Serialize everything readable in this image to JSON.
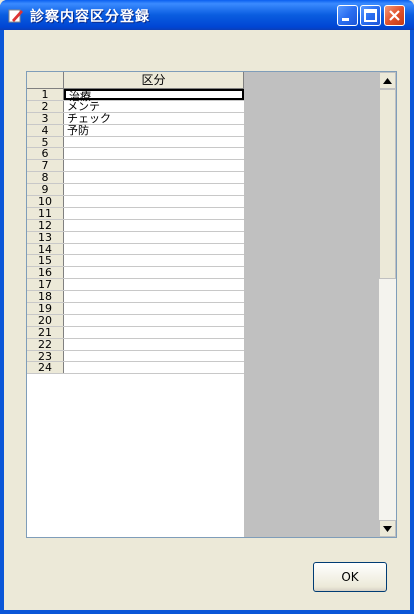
{
  "window": {
    "title": "診察内容区分登録"
  },
  "grid": {
    "column_header": "区分",
    "rows": [
      {
        "num": "1",
        "value": "治療"
      },
      {
        "num": "2",
        "value": "メンテ"
      },
      {
        "num": "3",
        "value": "チェック"
      },
      {
        "num": "4",
        "value": "予防"
      },
      {
        "num": "5",
        "value": ""
      },
      {
        "num": "6",
        "value": ""
      },
      {
        "num": "7",
        "value": ""
      },
      {
        "num": "8",
        "value": ""
      },
      {
        "num": "9",
        "value": ""
      },
      {
        "num": "10",
        "value": ""
      },
      {
        "num": "11",
        "value": ""
      },
      {
        "num": "12",
        "value": ""
      },
      {
        "num": "13",
        "value": ""
      },
      {
        "num": "14",
        "value": ""
      },
      {
        "num": "15",
        "value": ""
      },
      {
        "num": "16",
        "value": ""
      },
      {
        "num": "17",
        "value": ""
      },
      {
        "num": "18",
        "value": ""
      },
      {
        "num": "19",
        "value": ""
      },
      {
        "num": "20",
        "value": ""
      },
      {
        "num": "21",
        "value": ""
      },
      {
        "num": "22",
        "value": ""
      },
      {
        "num": "23",
        "value": ""
      },
      {
        "num": "24",
        "value": ""
      }
    ]
  },
  "buttons": {
    "ok": "OK"
  }
}
